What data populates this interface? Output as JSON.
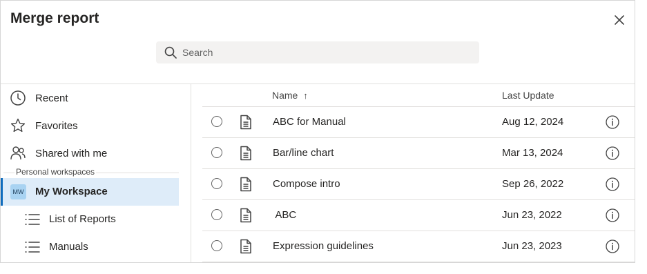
{
  "dialog": {
    "title": "Merge report",
    "close_icon": "close-icon"
  },
  "search": {
    "placeholder": "Search",
    "value": "",
    "icon": "search-icon"
  },
  "sidebar": {
    "items": [
      {
        "label": "Recent",
        "icon": "clock-icon"
      },
      {
        "label": "Favorites",
        "icon": "star-icon"
      },
      {
        "label": "Shared with me",
        "icon": "people-icon"
      }
    ],
    "section_label": "Personal workspaces",
    "workspace": {
      "badge": "MW",
      "label": "My Workspace",
      "selected": true,
      "accent": "#0f6cbd"
    },
    "sub_items": [
      {
        "label": "List of Reports",
        "icon": "list-icon"
      },
      {
        "label": "Manuals",
        "icon": "list-icon"
      }
    ]
  },
  "table": {
    "columns": {
      "name": "Name",
      "sort_indicator": "↑",
      "last_update": "Last Update"
    },
    "rows": [
      {
        "name": "ABC for Manual",
        "date": "Aug 12, 2024"
      },
      {
        "name": "Bar/line chart",
        "date": "Mar 13, 2024"
      },
      {
        "name": "Compose intro",
        "date": "Sep 26, 2022"
      },
      {
        "name": " ABC",
        "date": "Jun 23, 2022"
      },
      {
        "name": "Expression guidelines",
        "date": "Jun 23, 2023"
      }
    ]
  }
}
